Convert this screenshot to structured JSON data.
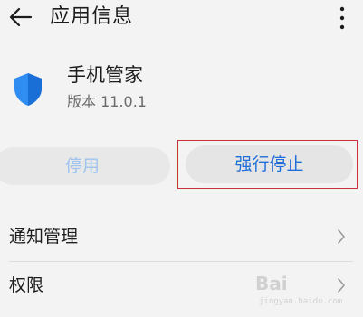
{
  "header": {
    "title": "应用信息"
  },
  "app": {
    "name": "手机管家",
    "version": "版本 11.0.1"
  },
  "actions": {
    "disable_label": "停用",
    "force_stop_label": "强行停止"
  },
  "settings": [
    {
      "label": "通知管理"
    },
    {
      "label": "权限"
    }
  ],
  "watermark": {
    "mark": "Bai",
    "sub": "jingyan.baidu.com"
  },
  "colors": {
    "accent": "#1e6fd9",
    "highlight": "#c9323b",
    "disabled_text": "#9ec3ee"
  }
}
